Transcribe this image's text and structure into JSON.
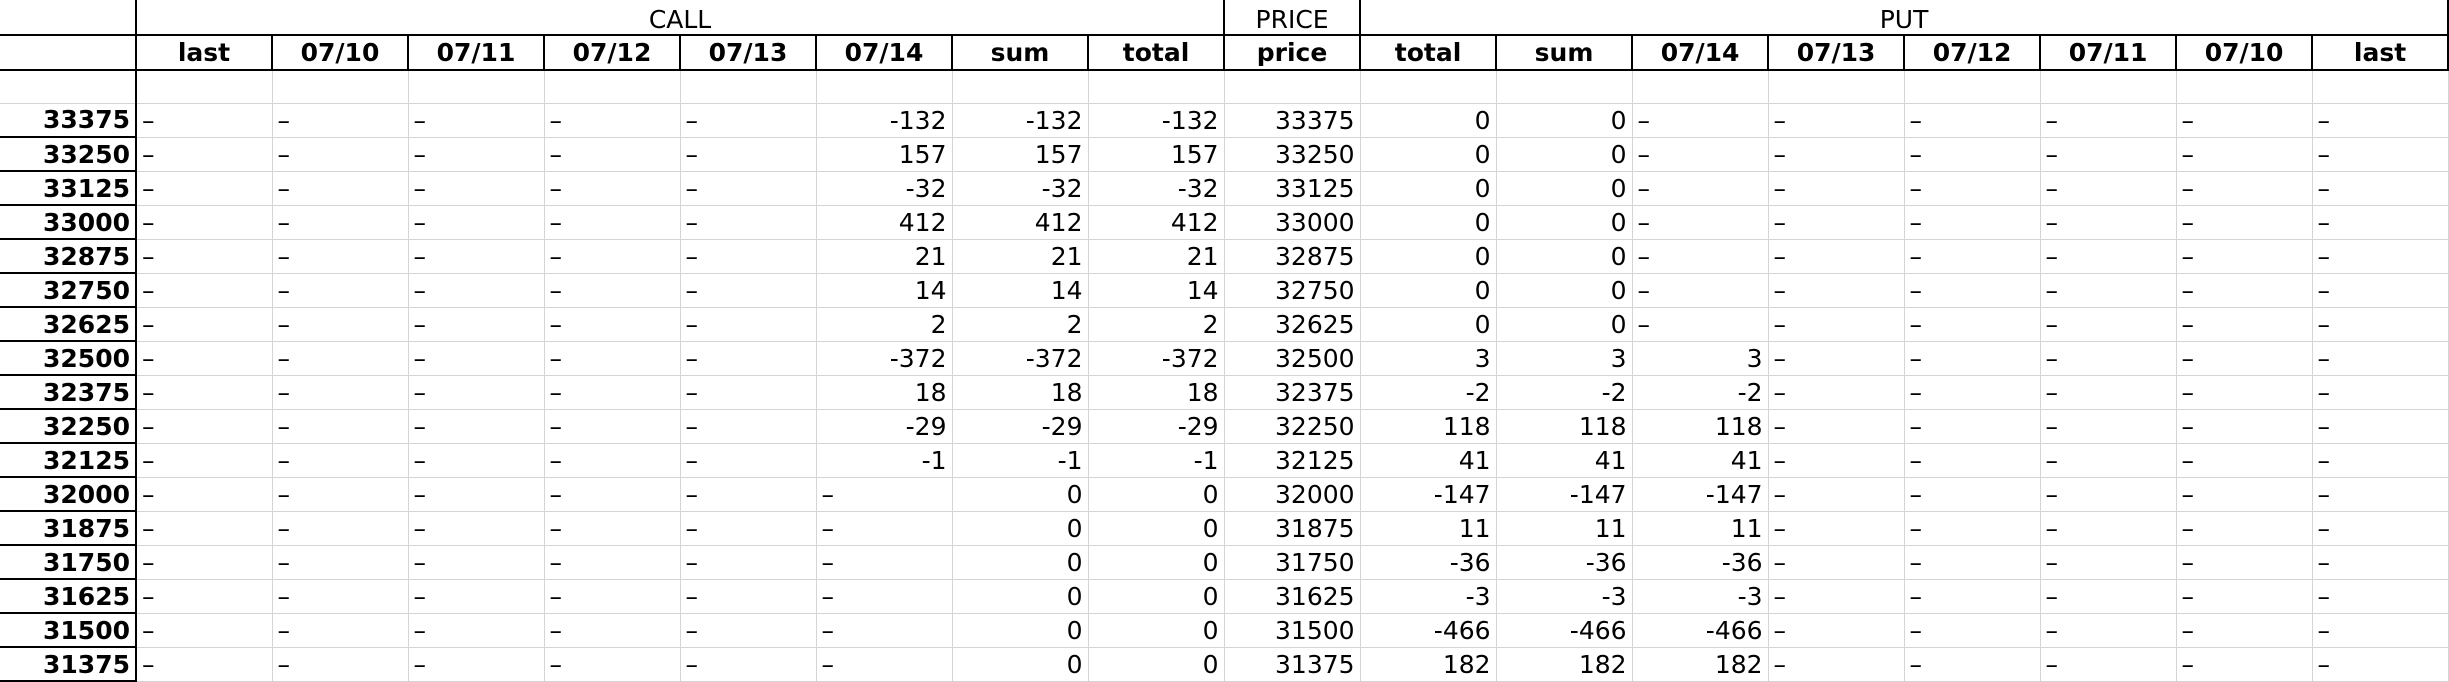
{
  "groups": {
    "call": "CALL",
    "price": "PRICE",
    "put": "PUT"
  },
  "columns": [
    "last",
    "07/10",
    "07/11",
    "07/12",
    "07/13",
    "07/14",
    "sum",
    "total",
    "price",
    "total",
    "sum",
    "07/14",
    "07/13",
    "07/12",
    "07/11",
    "07/10",
    "last"
  ],
  "rows": [
    [
      "33375",
      "–",
      "–",
      "–",
      "–",
      "–",
      "-132",
      "-132",
      "-132",
      "33375",
      "0",
      "0",
      "–",
      "–",
      "–",
      "–",
      "–",
      "–"
    ],
    [
      "33250",
      "–",
      "–",
      "–",
      "–",
      "–",
      "157",
      "157",
      "157",
      "33250",
      "0",
      "0",
      "–",
      "–",
      "–",
      "–",
      "–",
      "–"
    ],
    [
      "33125",
      "–",
      "–",
      "–",
      "–",
      "–",
      "-32",
      "-32",
      "-32",
      "33125",
      "0",
      "0",
      "–",
      "–",
      "–",
      "–",
      "–",
      "–"
    ],
    [
      "33000",
      "–",
      "–",
      "–",
      "–",
      "–",
      "412",
      "412",
      "412",
      "33000",
      "0",
      "0",
      "–",
      "–",
      "–",
      "–",
      "–",
      "–"
    ],
    [
      "32875",
      "–",
      "–",
      "–",
      "–",
      "–",
      "21",
      "21",
      "21",
      "32875",
      "0",
      "0",
      "–",
      "–",
      "–",
      "–",
      "–",
      "–"
    ],
    [
      "32750",
      "–",
      "–",
      "–",
      "–",
      "–",
      "14",
      "14",
      "14",
      "32750",
      "0",
      "0",
      "–",
      "–",
      "–",
      "–",
      "–",
      "–"
    ],
    [
      "32625",
      "–",
      "–",
      "–",
      "–",
      "–",
      "2",
      "2",
      "2",
      "32625",
      "0",
      "0",
      "–",
      "–",
      "–",
      "–",
      "–",
      "–"
    ],
    [
      "32500",
      "–",
      "–",
      "–",
      "–",
      "–",
      "-372",
      "-372",
      "-372",
      "32500",
      "3",
      "3",
      "3",
      "–",
      "–",
      "–",
      "–",
      "–"
    ],
    [
      "32375",
      "–",
      "–",
      "–",
      "–",
      "–",
      "18",
      "18",
      "18",
      "32375",
      "-2",
      "-2",
      "-2",
      "–",
      "–",
      "–",
      "–",
      "–"
    ],
    [
      "32250",
      "–",
      "–",
      "–",
      "–",
      "–",
      "-29",
      "-29",
      "-29",
      "32250",
      "118",
      "118",
      "118",
      "–",
      "–",
      "–",
      "–",
      "–"
    ],
    [
      "32125",
      "–",
      "–",
      "–",
      "–",
      "–",
      "-1",
      "-1",
      "-1",
      "32125",
      "41",
      "41",
      "41",
      "–",
      "–",
      "–",
      "–",
      "–"
    ],
    [
      "32000",
      "–",
      "–",
      "–",
      "–",
      "–",
      "–",
      "0",
      "0",
      "32000",
      "-147",
      "-147",
      "-147",
      "–",
      "–",
      "–",
      "–",
      "–"
    ],
    [
      "31875",
      "–",
      "–",
      "–",
      "–",
      "–",
      "–",
      "0",
      "0",
      "31875",
      "11",
      "11",
      "11",
      "–",
      "–",
      "–",
      "–",
      "–"
    ],
    [
      "31750",
      "–",
      "–",
      "–",
      "–",
      "–",
      "–",
      "0",
      "0",
      "31750",
      "-36",
      "-36",
      "-36",
      "–",
      "–",
      "–",
      "–",
      "–"
    ],
    [
      "31625",
      "–",
      "–",
      "–",
      "–",
      "–",
      "–",
      "0",
      "0",
      "31625",
      "-3",
      "-3",
      "-3",
      "–",
      "–",
      "–",
      "–",
      "–"
    ],
    [
      "31500",
      "–",
      "–",
      "–",
      "–",
      "–",
      "–",
      "0",
      "0",
      "31500",
      "-466",
      "-466",
      "-466",
      "–",
      "–",
      "–",
      "–",
      "–"
    ],
    [
      "31375",
      "–",
      "–",
      "–",
      "–",
      "–",
      "–",
      "0",
      "0",
      "31375",
      "182",
      "182",
      "182",
      "–",
      "–",
      "–",
      "–",
      "–"
    ]
  ]
}
